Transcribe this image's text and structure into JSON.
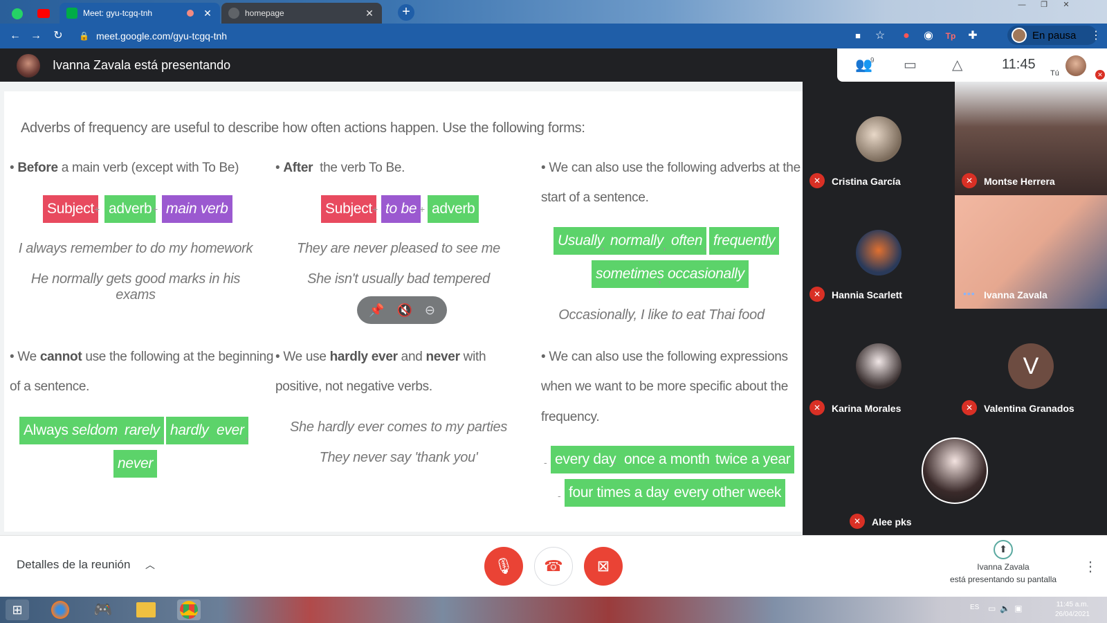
{
  "browser": {
    "tabs": [
      {
        "title": "Meet: gyu-tcgq-tnh",
        "active": true
      },
      {
        "title": "homepage",
        "active": false
      }
    ],
    "url": "meet.google.com/gyu-tcgq-tnh",
    "profile_label": "En pausa"
  },
  "meet": {
    "presenting_text": "Ivanna Zavala está presentando",
    "clock": "11:45",
    "self_label": "Tú",
    "participant_count_badge": "9",
    "details_label": "Detalles de la reunión",
    "presenter_name": "Ivanna Zavala",
    "presenter_status": "está presentando su pantalla",
    "accent_red": "#ea4335"
  },
  "slide": {
    "intro": "Adverbs of frequency are useful to describe how often actions happen. Use the following forms:",
    "col1": {
      "bold": "Before",
      "rest": "a main verb (except with To Be)",
      "chips": [
        "Subject",
        "adverb",
        "main verb"
      ],
      "examples": [
        "I always remember to do my homework",
        "He normally gets good marks in his exams"
      ]
    },
    "col2": {
      "bold": "After",
      "rest": "the verb To Be.",
      "chips": [
        "Subject",
        "to be",
        "adverb"
      ],
      "examples": [
        "They are never pleased to see me",
        "She isn't usually bad tempered"
      ]
    },
    "col3": {
      "line1": "• We can also use the following adverbs at the",
      "line2": "start of a sentence.",
      "chips": [
        "Usually",
        "normally",
        "often",
        "frequently",
        "sometimes",
        "occasionally"
      ],
      "example": "Occasionally, I like to eat Thai food"
    },
    "col4": {
      "pre": "• We",
      "bold": "cannot",
      "post": "use the following at the beginning",
      "line2": "of a sentence.",
      "chips": [
        "Always",
        "seldom",
        "rarely",
        "hardly",
        "ever",
        "never"
      ]
    },
    "col5": {
      "pre": "• We use",
      "bold1": "hardly ever",
      "mid": "and",
      "bold2": "never",
      "post": "with",
      "line2": "positive, not negative verbs.",
      "examples": [
        "She hardly ever comes to my parties",
        "They never say 'thank you'"
      ]
    },
    "col6": {
      "line1": "• We can also use the following expressions",
      "line2": "when we want to be more specific about the",
      "line3": "frequency.",
      "chips": [
        "every day",
        "once a month",
        "twice a year",
        "four times a day",
        "every other week"
      ]
    },
    "colors": {
      "red": "#e84a5f",
      "green": "#5cd36a",
      "purple": "#9b59d0"
    }
  },
  "participants": [
    {
      "name": "Cristina García",
      "muted": true
    },
    {
      "name": "Montse Herrera",
      "muted": true
    },
    {
      "name": "Hannia Scarlett",
      "muted": true
    },
    {
      "name": "Ivanna Zavala",
      "muted": false,
      "speaking": true
    },
    {
      "name": "Karina Morales",
      "muted": true
    },
    {
      "name": "Valentina Granados",
      "muted": true,
      "initial": "V"
    },
    {
      "name": "Alee pks",
      "muted": true
    }
  ],
  "taskbar": {
    "lang": "ES",
    "time": "11:45 a.m.",
    "date": "26/04/2021"
  }
}
